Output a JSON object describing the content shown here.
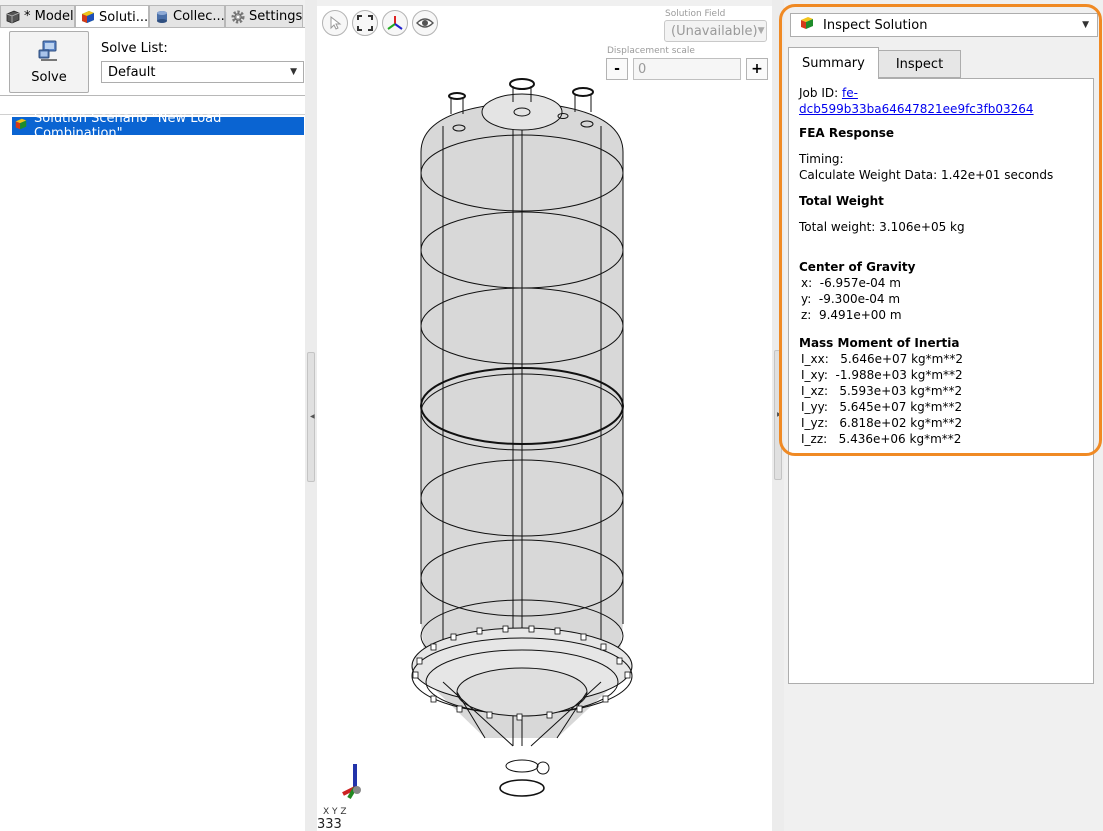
{
  "left_tabs": [
    {
      "label": "* Model",
      "icon": "model-icon"
    },
    {
      "label": "Soluti...",
      "icon": "solution-icon"
    },
    {
      "label": "Collec...",
      "icon": "collection-icon"
    },
    {
      "label": "Settings",
      "icon": "gear-icon"
    }
  ],
  "left_toolbar": {
    "solve_label": "Solve",
    "solve_list_label": "Solve List:",
    "solve_list_value": "Default"
  },
  "tree": {
    "items": [
      {
        "label": "Solution Scenario \"New Load Combination\"",
        "selected": true
      }
    ]
  },
  "viewport": {
    "solution_field_label": "Solution Field",
    "solution_field_value": "(Unavailable)",
    "displacement_scale_label": "Displacement scale",
    "displacement_scale_value": "0",
    "minus_label": "-",
    "plus_label": "+",
    "axis_label": "X Y Z",
    "frame_counter": "333"
  },
  "right_panel": {
    "selector_label": "Inspect Solution",
    "tabs": [
      "Summary",
      "Inspect"
    ],
    "job_id_label": "Job ID:",
    "job_id_value": "fe-dcb599b33ba64647821ee9fc3fb03264",
    "fea_heading": "FEA Response",
    "timing_label": "Timing:",
    "timing_value": "Calculate Weight Data: 1.42e+01 seconds",
    "total_weight_heading": "Total Weight",
    "total_weight_value": "Total weight: 3.106e+05 kg",
    "cog_heading": "Center of Gravity",
    "cog": [
      "x:  -6.957e-04 m",
      "y:  -9.300e-04 m",
      "z:  9.491e+00 m"
    ],
    "inertia_heading": "Mass Moment of Inertia",
    "inertia": [
      "I_xx:   5.646e+07 kg*m**2",
      "I_xy:  -1.988e+03 kg*m**2",
      "I_xz:   5.593e+03 kg*m**2",
      "I_yy:   5.645e+07 kg*m**2",
      "I_yz:   6.818e+02 kg*m**2",
      "I_zz:   5.436e+06 kg*m**2"
    ]
  },
  "colors": {
    "selection": "#0a64d2",
    "highlight": "#f08a24",
    "link": "#0000ee"
  }
}
